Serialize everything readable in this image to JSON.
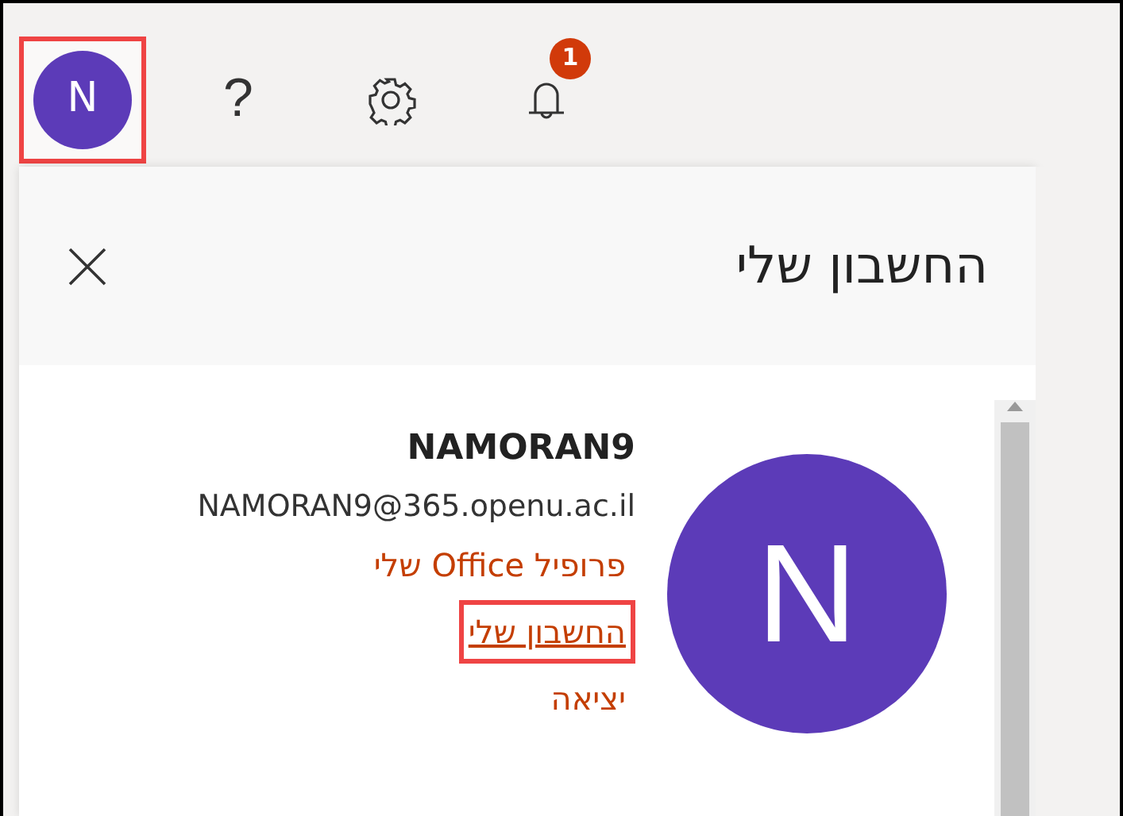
{
  "top_bar": {
    "avatar": {
      "initial": "N",
      "highlighted": true
    },
    "help": {
      "label": "?"
    },
    "notifications": {
      "badge": "1"
    }
  },
  "panel": {
    "title": "החשבון שלי",
    "account": {
      "initial": "N",
      "name": "NAMORAN9",
      "email": "NAMORAN9@365.openu.ac.il"
    },
    "links": [
      {
        "label": "פרופיל Office שלי",
        "underlined": false,
        "highlighted": false
      },
      {
        "label": "החשבון שלי",
        "underlined": true,
        "highlighted": true
      },
      {
        "label": "יציאה",
        "underlined": false,
        "highlighted": false
      }
    ]
  }
}
